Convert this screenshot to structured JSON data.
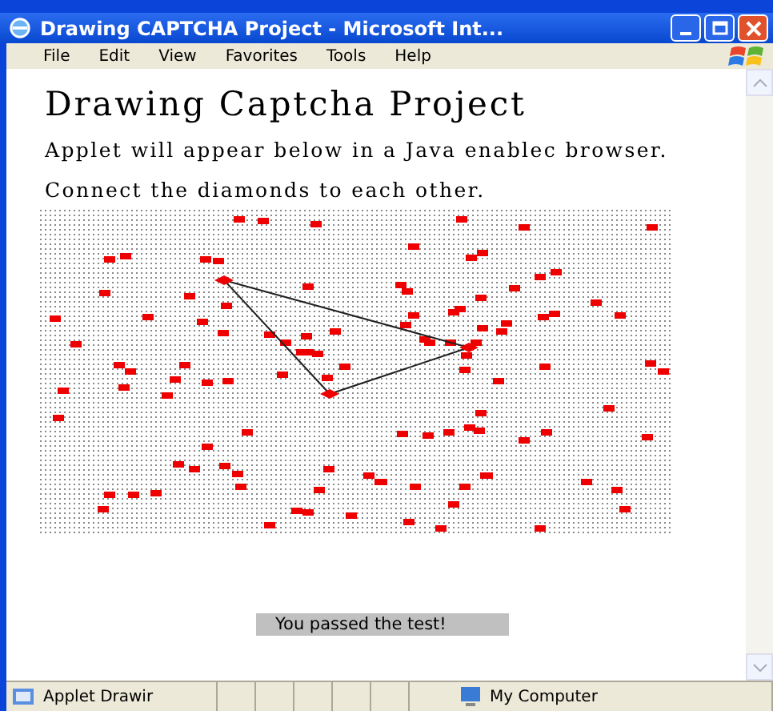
{
  "window": {
    "title": "Drawing CAPTCHA Project - Microsoft Int..."
  },
  "menu": [
    "File",
    "Edit",
    "View",
    "Favorites",
    "Tools",
    "Help"
  ],
  "page": {
    "heading": "Drawing Captcha Project",
    "paragraphs": [
      "Applet will appear below in a Java enablec browser.",
      "Connect the diamonds to each other."
    ],
    "result": "You passed the test!"
  },
  "status_bar": {
    "left": "Applet Drawir",
    "zone": "My Computer"
  }
}
